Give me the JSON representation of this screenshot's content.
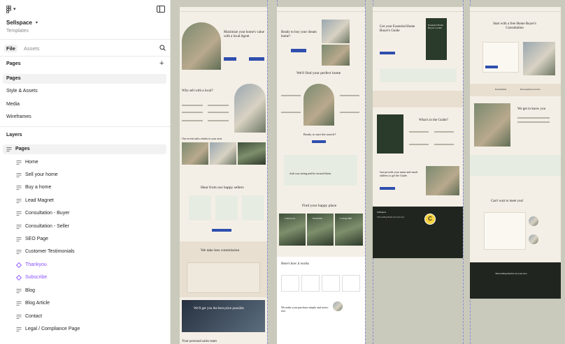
{
  "project": {
    "name": "Sellspace",
    "subtitle": "Templates"
  },
  "tabs": [
    {
      "label": "File",
      "active": true
    },
    {
      "label": "Assets",
      "active": false
    }
  ],
  "pages_section": {
    "title": "Pages",
    "items": [
      {
        "label": "Pages",
        "selected": true
      },
      {
        "label": "Style & Assets",
        "selected": false
      },
      {
        "label": "Media",
        "selected": false
      },
      {
        "label": "Wireframes",
        "selected": false
      }
    ]
  },
  "layers_section": {
    "title": "Layers",
    "items": [
      {
        "label": "Pages",
        "icon": "frame-icon",
        "level": 0,
        "selected": true
      },
      {
        "label": "Home",
        "icon": "section-icon",
        "level": 1
      },
      {
        "label": "Sell your home",
        "icon": "section-icon",
        "level": 1
      },
      {
        "label": "Buy a home",
        "icon": "section-icon",
        "level": 1
      },
      {
        "label": "Lead Magnet",
        "icon": "section-icon",
        "level": 1
      },
      {
        "label": "Consultation - Buyer",
        "icon": "section-icon",
        "level": 1
      },
      {
        "label": "Consultation - Seller",
        "icon": "section-icon",
        "level": 1
      },
      {
        "label": "SEO Page",
        "icon": "section-icon",
        "level": 1
      },
      {
        "label": "Customer Testimonials",
        "icon": "section-icon",
        "level": 1
      },
      {
        "label": "Thankyou",
        "icon": "component-icon",
        "level": 1,
        "color": "#8a4fff"
      },
      {
        "label": "Subscribe",
        "icon": "component-icon",
        "level": 1,
        "color": "#8a4fff"
      },
      {
        "label": "Blog",
        "icon": "section-icon",
        "level": 1
      },
      {
        "label": "Blog Article",
        "icon": "section-icon",
        "level": 1
      },
      {
        "label": "Contact",
        "icon": "section-icon",
        "level": 1
      },
      {
        "label": "Legal / Compliance Page",
        "icon": "section-icon",
        "level": 1
      }
    ]
  },
  "canvas": {
    "collaborator_initial": "C",
    "frames": [
      {
        "heading": "Maximize your home's value with a local Agent",
        "h2": "Why sell with a local?",
        "h3": "Our recent sales results in your area",
        "h4": "Hear from our happy sellers",
        "h5": "We take less commission",
        "h6": "We'll get you the best price possible",
        "h7": "Your personal sales team"
      },
      {
        "heading": "Ready to buy your dream home?",
        "h2": "We'll find your perfect home",
        "h3": "Ready to start the search?",
        "quote": "Josh was seeing and he secured them",
        "h4": "Find your happy place",
        "cards": [
          "Lakewood",
          "Northdale",
          "College Hill"
        ],
        "h5": "Here's how it works",
        "h6": "We make your purchase simple and stress-free"
      },
      {
        "heading": "Get your Essential Home Buyer's Guide",
        "book": "Essential Home Buyer's Guide",
        "h2": "What's in the Guide?",
        "h3": "Just provide your name and email address to get the Guide.",
        "footer_brand": "Sellspace",
        "footer_tag": "The leading Realtor in your area"
      },
      {
        "heading": "Start with a free Home Buyer's Consultation",
        "h2": "We get to know you",
        "h3": "Can't wait to meet you!",
        "footer_tag": "The leading Realtor in your area",
        "strip": [
          "Established",
          "Personalized service"
        ]
      }
    ]
  },
  "colors": {
    "canvas_bg": "#c9cabb",
    "accent_purple": "#8a4fff",
    "frame_bg": "#f4efe6",
    "dark_footer": "#20261f",
    "cta_blue": "#2f4fae"
  }
}
